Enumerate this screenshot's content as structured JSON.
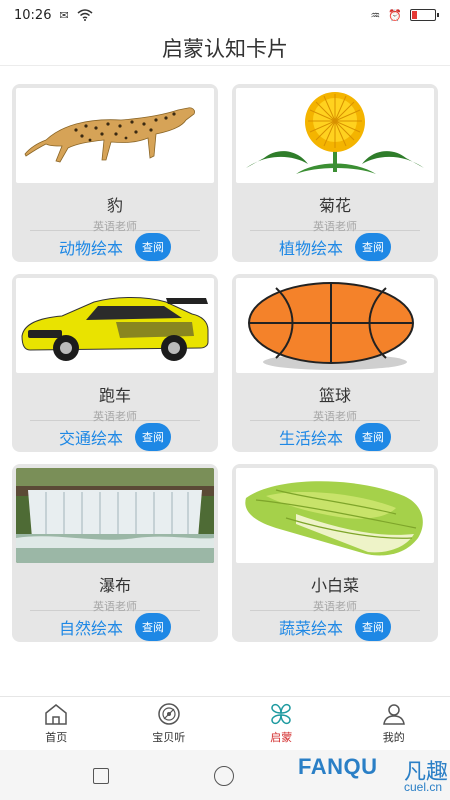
{
  "status_bar": {
    "time": "10:26"
  },
  "header": {
    "title": "启蒙认知卡片"
  },
  "cards": [
    {
      "title": "豹",
      "author": "英语老师",
      "category": "动物绘本",
      "button": "查阅",
      "image": "cheetah"
    },
    {
      "title": "菊花",
      "author": "英语老师",
      "category": "植物绘本",
      "button": "查阅",
      "image": "chrysanthemum"
    },
    {
      "title": "跑车",
      "author": "英语老师",
      "category": "交通绘本",
      "button": "查阅",
      "image": "sports-car"
    },
    {
      "title": "篮球",
      "author": "英语老师",
      "category": "生活绘本",
      "button": "查阅",
      "image": "basketball"
    },
    {
      "title": "瀑布",
      "author": "英语老师",
      "category": "自然绘本",
      "button": "查阅",
      "image": "waterfall"
    },
    {
      "title": "小白菜",
      "author": "英语老师",
      "category": "蔬菜绘本",
      "button": "查阅",
      "image": "bok-choy"
    }
  ],
  "tab_bar": {
    "tabs": [
      {
        "label": "首页",
        "icon": "home-icon"
      },
      {
        "label": "宝贝听",
        "icon": "disc-icon"
      },
      {
        "label": "启蒙",
        "icon": "clover-icon",
        "active": true
      },
      {
        "label": "我的",
        "icon": "user-icon"
      }
    ]
  },
  "watermark": {
    "brand": "FANQU",
    "chinese": "凡趣",
    "url": "cuel.cn"
  },
  "colors": {
    "accent": "#1e88e5",
    "active_tab": "#d32f2f",
    "card_bg": "#e6e6e6"
  }
}
